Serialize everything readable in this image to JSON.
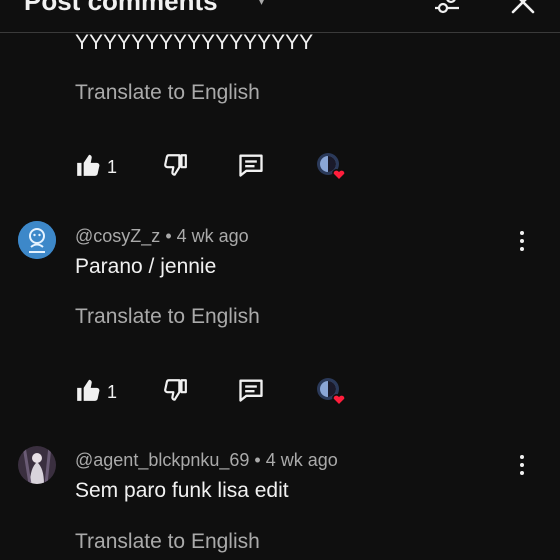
{
  "header": {
    "title": "Post comments",
    "icons": [
      "filter-icon",
      "close-icon"
    ]
  },
  "comments": [
    {
      "author": "",
      "age": "",
      "text": "YYYYYYYYYYYYYYYYY",
      "translate_label": "Translate to English",
      "likes": "1"
    },
    {
      "author": "@cosyZ_z",
      "separator": "•",
      "age": "4 wk ago",
      "text": "Parano / jennie",
      "translate_label": "Translate to English",
      "likes": "1"
    },
    {
      "author": "@agent_blckpnku_69",
      "separator": "•",
      "age": "4 wk ago",
      "text": "Sem paro funk lisa edit",
      "translate_label": "Translate to English"
    }
  ],
  "colors": {
    "background": "#0f0f0f",
    "primary_text": "#f1f1f1",
    "secondary_text": "#aaaaaa",
    "heart": "#ff1e3c"
  }
}
